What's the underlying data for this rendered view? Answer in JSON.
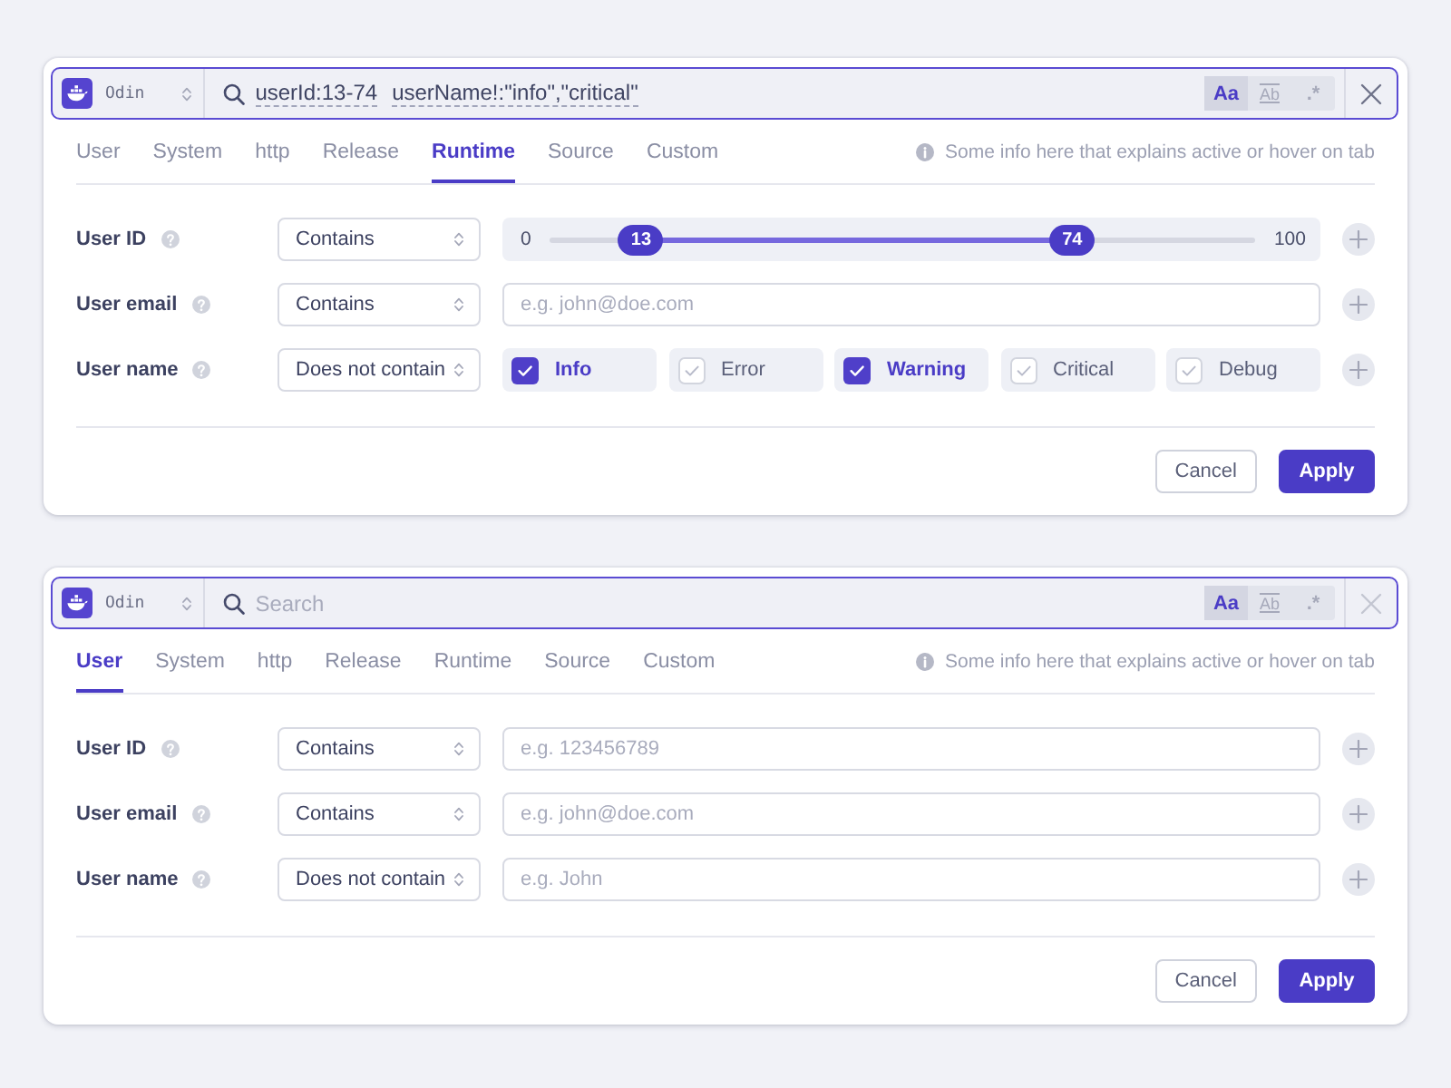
{
  "panels": [
    {
      "search": {
        "source": "Odin",
        "query": [
          "userId:13-74",
          "userName!:\"info\",\"critical\""
        ],
        "options": [
          {
            "kind": "case",
            "label": "Aa",
            "selected": true
          },
          {
            "kind": "word",
            "label": "Ab",
            "selected": false
          },
          {
            "kind": "regex",
            "label": ".*",
            "selected": false
          }
        ],
        "clear": {
          "disabled": false
        }
      },
      "tabs": [
        {
          "label": "User",
          "selected": false
        },
        {
          "label": "System",
          "selected": false
        },
        {
          "label": "http",
          "selected": false
        },
        {
          "label": "Release",
          "selected": false
        },
        {
          "label": "Runtime",
          "selected": true
        },
        {
          "label": "Source",
          "selected": false
        },
        {
          "label": "Custom",
          "selected": false
        }
      ],
      "hint": "Some info here that explains active or hover on tab",
      "rows": [
        {
          "label": "User ID",
          "operator": "Contains",
          "kind": "range",
          "min": "0",
          "max": "100",
          "thumbs": [
            {
              "label": "13",
              "level": 0.13
            },
            {
              "label": "74",
              "level": 0.74
            }
          ]
        },
        {
          "label": "User email",
          "operator": "Contains",
          "kind": "text",
          "placeholder": "e.g. john@doe.com"
        },
        {
          "label": "User name",
          "operator": "Does not contain",
          "kind": "checkboxes",
          "options": [
            {
              "label": "Info",
              "checked": true
            },
            {
              "label": "Error",
              "checked": false
            },
            {
              "label": "Warning",
              "checked": true
            },
            {
              "label": "Critical",
              "checked": false
            },
            {
              "label": "Debug",
              "checked": false
            }
          ]
        }
      ],
      "buttons": [
        {
          "label": "Cancel",
          "kind": "secondary"
        },
        {
          "label": "Apply",
          "kind": "primary"
        }
      ]
    },
    {
      "search": {
        "source": "Odin",
        "placeholder": "Search",
        "options": [
          {
            "kind": "case",
            "label": "Aa",
            "selected": true
          },
          {
            "kind": "word",
            "label": "Ab",
            "selected": false
          },
          {
            "kind": "regex",
            "label": ".*",
            "selected": false
          }
        ],
        "clear": {
          "disabled": true
        }
      },
      "tabs": [
        {
          "label": "User",
          "selected": true
        },
        {
          "label": "System",
          "selected": false
        },
        {
          "label": "http",
          "selected": false
        },
        {
          "label": "Release",
          "selected": false
        },
        {
          "label": "Runtime",
          "selected": false
        },
        {
          "label": "Source",
          "selected": false
        },
        {
          "label": "Custom",
          "selected": false
        }
      ],
      "hint": "Some info here that explains active or hover on tab",
      "rows": [
        {
          "label": "User ID",
          "operator": "Contains",
          "kind": "text",
          "placeholder": "e.g. 123456789"
        },
        {
          "label": "User email",
          "operator": "Contains",
          "kind": "text",
          "placeholder": "e.g. john@doe.com"
        },
        {
          "label": "User name",
          "operator": "Does not contain",
          "kind": "text",
          "placeholder": "e.g. John"
        }
      ],
      "buttons": [
        {
          "label": "Cancel",
          "kind": "secondary"
        },
        {
          "label": "Apply",
          "kind": "primary"
        }
      ]
    }
  ]
}
